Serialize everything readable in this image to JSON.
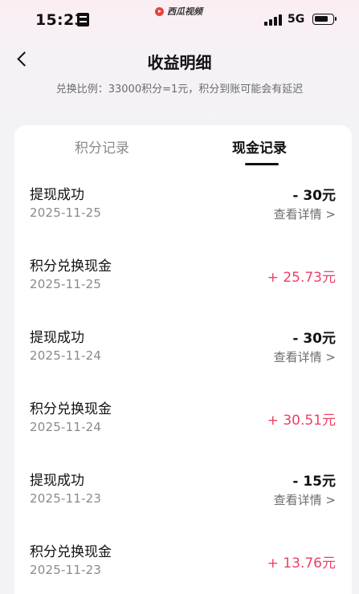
{
  "status_bar": {
    "time": "15:23",
    "notification_app": "西瓜视频",
    "network": "5G"
  },
  "header": {
    "title": "收益明细",
    "exchange_note": "兑换比例：33000积分=1元，积分到账可能会有延迟"
  },
  "tabs": [
    {
      "label": "积分记录",
      "active": false
    },
    {
      "label": "现金记录",
      "active": true
    }
  ],
  "records": [
    {
      "title": "提现成功",
      "date": "2025-11-25",
      "amount": "- 30元",
      "type": "withdraw",
      "detail": "查看详情 >"
    },
    {
      "title": "积分兑换现金",
      "date": "2025-11-25",
      "amount": "+ 25.73元",
      "type": "exchange",
      "detail": ""
    },
    {
      "title": "提现成功",
      "date": "2025-11-24",
      "amount": "- 30元",
      "type": "withdraw",
      "detail": "查看详情 >"
    },
    {
      "title": "积分兑换现金",
      "date": "2025-11-24",
      "amount": "+ 30.51元",
      "type": "exchange",
      "detail": ""
    },
    {
      "title": "提现成功",
      "date": "2025-11-23",
      "amount": "- 15元",
      "type": "withdraw",
      "detail": "查看详情 >"
    },
    {
      "title": "积分兑换现金",
      "date": "2025-11-23",
      "amount": "+ 13.76元",
      "type": "exchange",
      "detail": ""
    }
  ],
  "colors": {
    "positive_amount": "#ee3f64",
    "negative_amount": "#111111",
    "notification_icon": "#e8423a"
  },
  "icons": {
    "back": "chevron-left-icon",
    "notification": "xigua-video-icon",
    "sim_card": "sim-card-icon",
    "signal": "signal-icon",
    "battery": "battery-icon"
  }
}
